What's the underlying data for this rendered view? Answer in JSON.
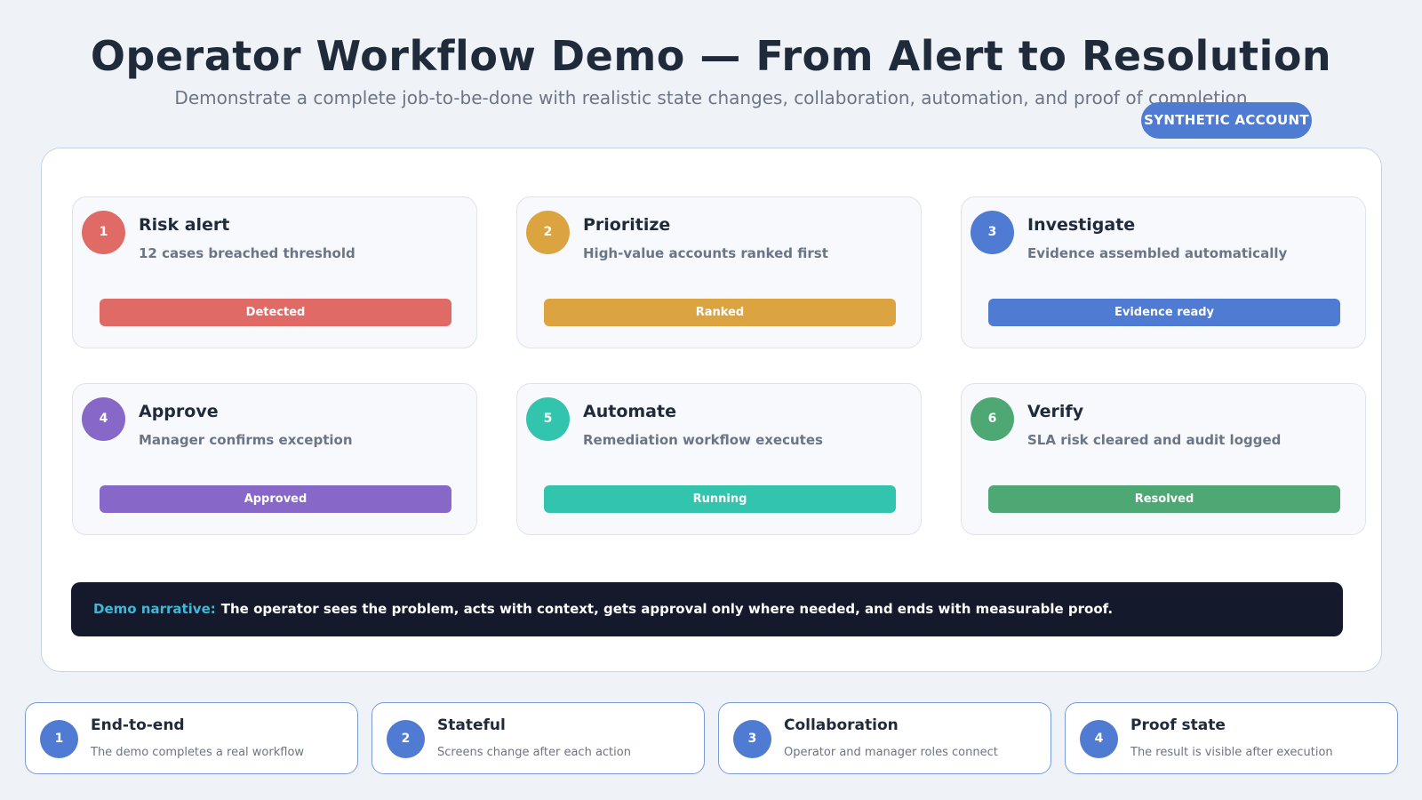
{
  "header": {
    "title": "Operator Workflow Demo — From Alert to Resolution",
    "subtitle": "Demonstrate a complete job-to-be-done with realistic state changes, collaboration, automation, and proof of completion",
    "badge": "SYNTHETIC ACCOUNT"
  },
  "steps": [
    {
      "num": "1",
      "title": "Risk alert",
      "desc": "12 cases breached threshold",
      "status": "Detected",
      "color": "#e06b66"
    },
    {
      "num": "2",
      "title": "Prioritize",
      "desc": "High-value accounts ranked first",
      "status": "Ranked",
      "color": "#dba441"
    },
    {
      "num": "3",
      "title": "Investigate",
      "desc": "Evidence assembled automatically",
      "status": "Evidence ready",
      "color": "#507bd2"
    },
    {
      "num": "4",
      "title": "Approve",
      "desc": "Manager confirms exception",
      "status": "Approved",
      "color": "#8767c8"
    },
    {
      "num": "5",
      "title": "Automate",
      "desc": "Remediation workflow executes",
      "status": "Running",
      "color": "#33c4ae"
    },
    {
      "num": "6",
      "title": "Verify",
      "desc": "SLA risk cleared and audit logged",
      "status": "Resolved",
      "color": "#4ea874"
    }
  ],
  "narrative": {
    "label": "Demo narrative:",
    "text": "The operator sees the problem, acts with context, gets approval only where needed, and ends with measurable proof."
  },
  "features": [
    {
      "num": "1",
      "title": "End-to-end",
      "desc": "The demo completes a real workflow"
    },
    {
      "num": "2",
      "title": "Stateful",
      "desc": "Screens change after each action"
    },
    {
      "num": "3",
      "title": "Collaboration",
      "desc": "Operator and manager roles connect"
    },
    {
      "num": "4",
      "title": "Proof state",
      "desc": "The result is visible after execution"
    }
  ]
}
